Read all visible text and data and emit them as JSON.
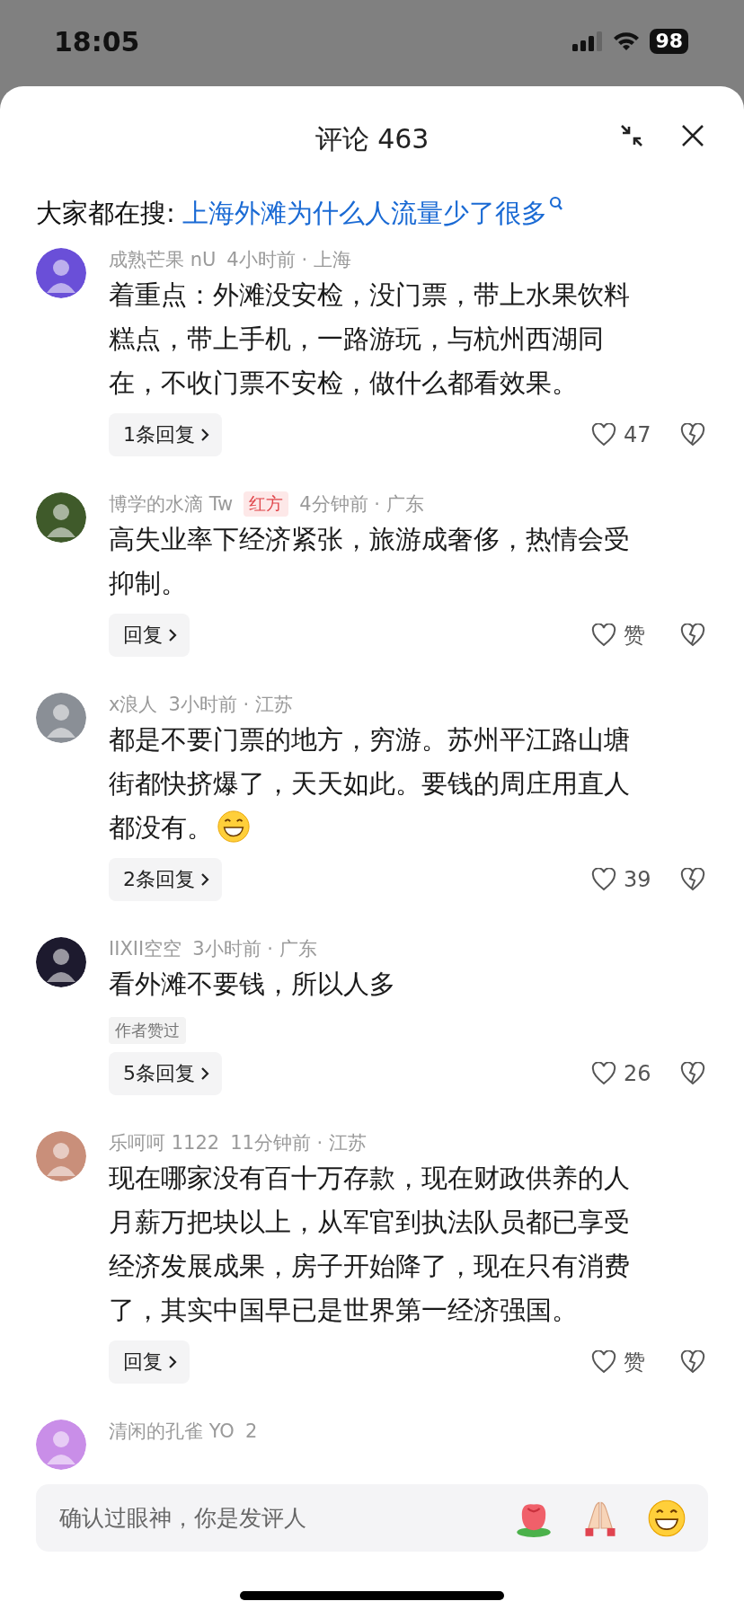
{
  "status_bar": {
    "time": "18:05",
    "battery": "98"
  },
  "header": {
    "title": "评论 463"
  },
  "hot_search": {
    "label": "大家都在搜:",
    "query": "上海外滩为什么人流量少了很多"
  },
  "comments": [
    {
      "author": "成熟芒果 nU",
      "time": "4小时前 · 上海",
      "text": "着重点：外滩没安检，没门票，带上水果饮料糕点，带上手机，一路游玩，与杭州西湖同在，不收门票不安检，做什么都看效果。",
      "has_emoji": false,
      "replies": "1条回复",
      "likes": "47"
    },
    {
      "author": "博学的水滴 Tw",
      "badge": "红方",
      "time": "4分钟前 · 广东",
      "text": "高失业率下经济紧张，旅游成奢侈，热情会受抑制。",
      "has_emoji": false,
      "replies": "回复",
      "likes": "赞"
    },
    {
      "author": "x浪人",
      "time": "3小时前 · 江苏",
      "text": "都是不要门票的地方，穷游。苏州平江路山塘街都快挤爆了，天天如此。要钱的周庄用直人都没有。",
      "has_emoji": true,
      "replies": "2条回复",
      "likes": "39"
    },
    {
      "author": "IIXII空空",
      "time": "3小时前 · 广东",
      "text": "看外滩不要钱，所以人多",
      "has_emoji": false,
      "tag": "作者赞过",
      "replies": "5条回复",
      "likes": "26"
    },
    {
      "author": "乐呵呵 1122",
      "time": "11分钟前 · 江苏",
      "text": "现在哪家没有百十万存款，现在财政供养的人月薪万把块以上，从军官到执法队员都已享受经济发展成果，房子开始降了，现在只有消费了，其实中国早已是世界第一经济强国。",
      "has_emoji": false,
      "replies": "回复",
      "likes": "赞"
    },
    {
      "author": "清闲的孔雀 YO",
      "time": "2"
    }
  ],
  "composer": {
    "placeholder": "确认过眼神，你是发评人"
  }
}
